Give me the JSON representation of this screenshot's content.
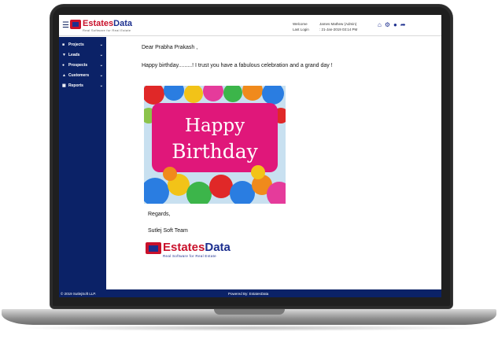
{
  "header": {
    "logo_word_1": "Estates",
    "logo_word_2": "Data",
    "logo_tagline": "Real Software for Real Estate",
    "welcome_label": "Welcome",
    "welcome_value": "James Mathew (Admin)",
    "last_login_label": "Last Login",
    "last_login_value": ": 21-Jan-2019 03:14 PM"
  },
  "sidebar": {
    "items": [
      {
        "label": "Projects",
        "icon": "building-icon"
      },
      {
        "label": "Leads",
        "icon": "funnel-icon"
      },
      {
        "label": "Prospects",
        "icon": "users-icon"
      },
      {
        "label": "Customers",
        "icon": "user-icon"
      },
      {
        "label": "Reports",
        "icon": "chart-icon"
      }
    ]
  },
  "email": {
    "greeting": "Dear Prabha Prakash ,",
    "message": "Happy birthday.........!  I trust you have a fabulous celebration and a grand day !",
    "card_line_1": "Happy",
    "card_line_2": "Birthday",
    "regards": "Regards,",
    "team": "Sutlej Soft Team"
  },
  "footer": {
    "copyright": "© 2019 SutlejSoft LLP.",
    "powered": "Powered By: EstatesData"
  },
  "colors": {
    "brand_navy": "#0b2267",
    "brand_red": "#c9112b",
    "card_pink": "#e0177a"
  }
}
